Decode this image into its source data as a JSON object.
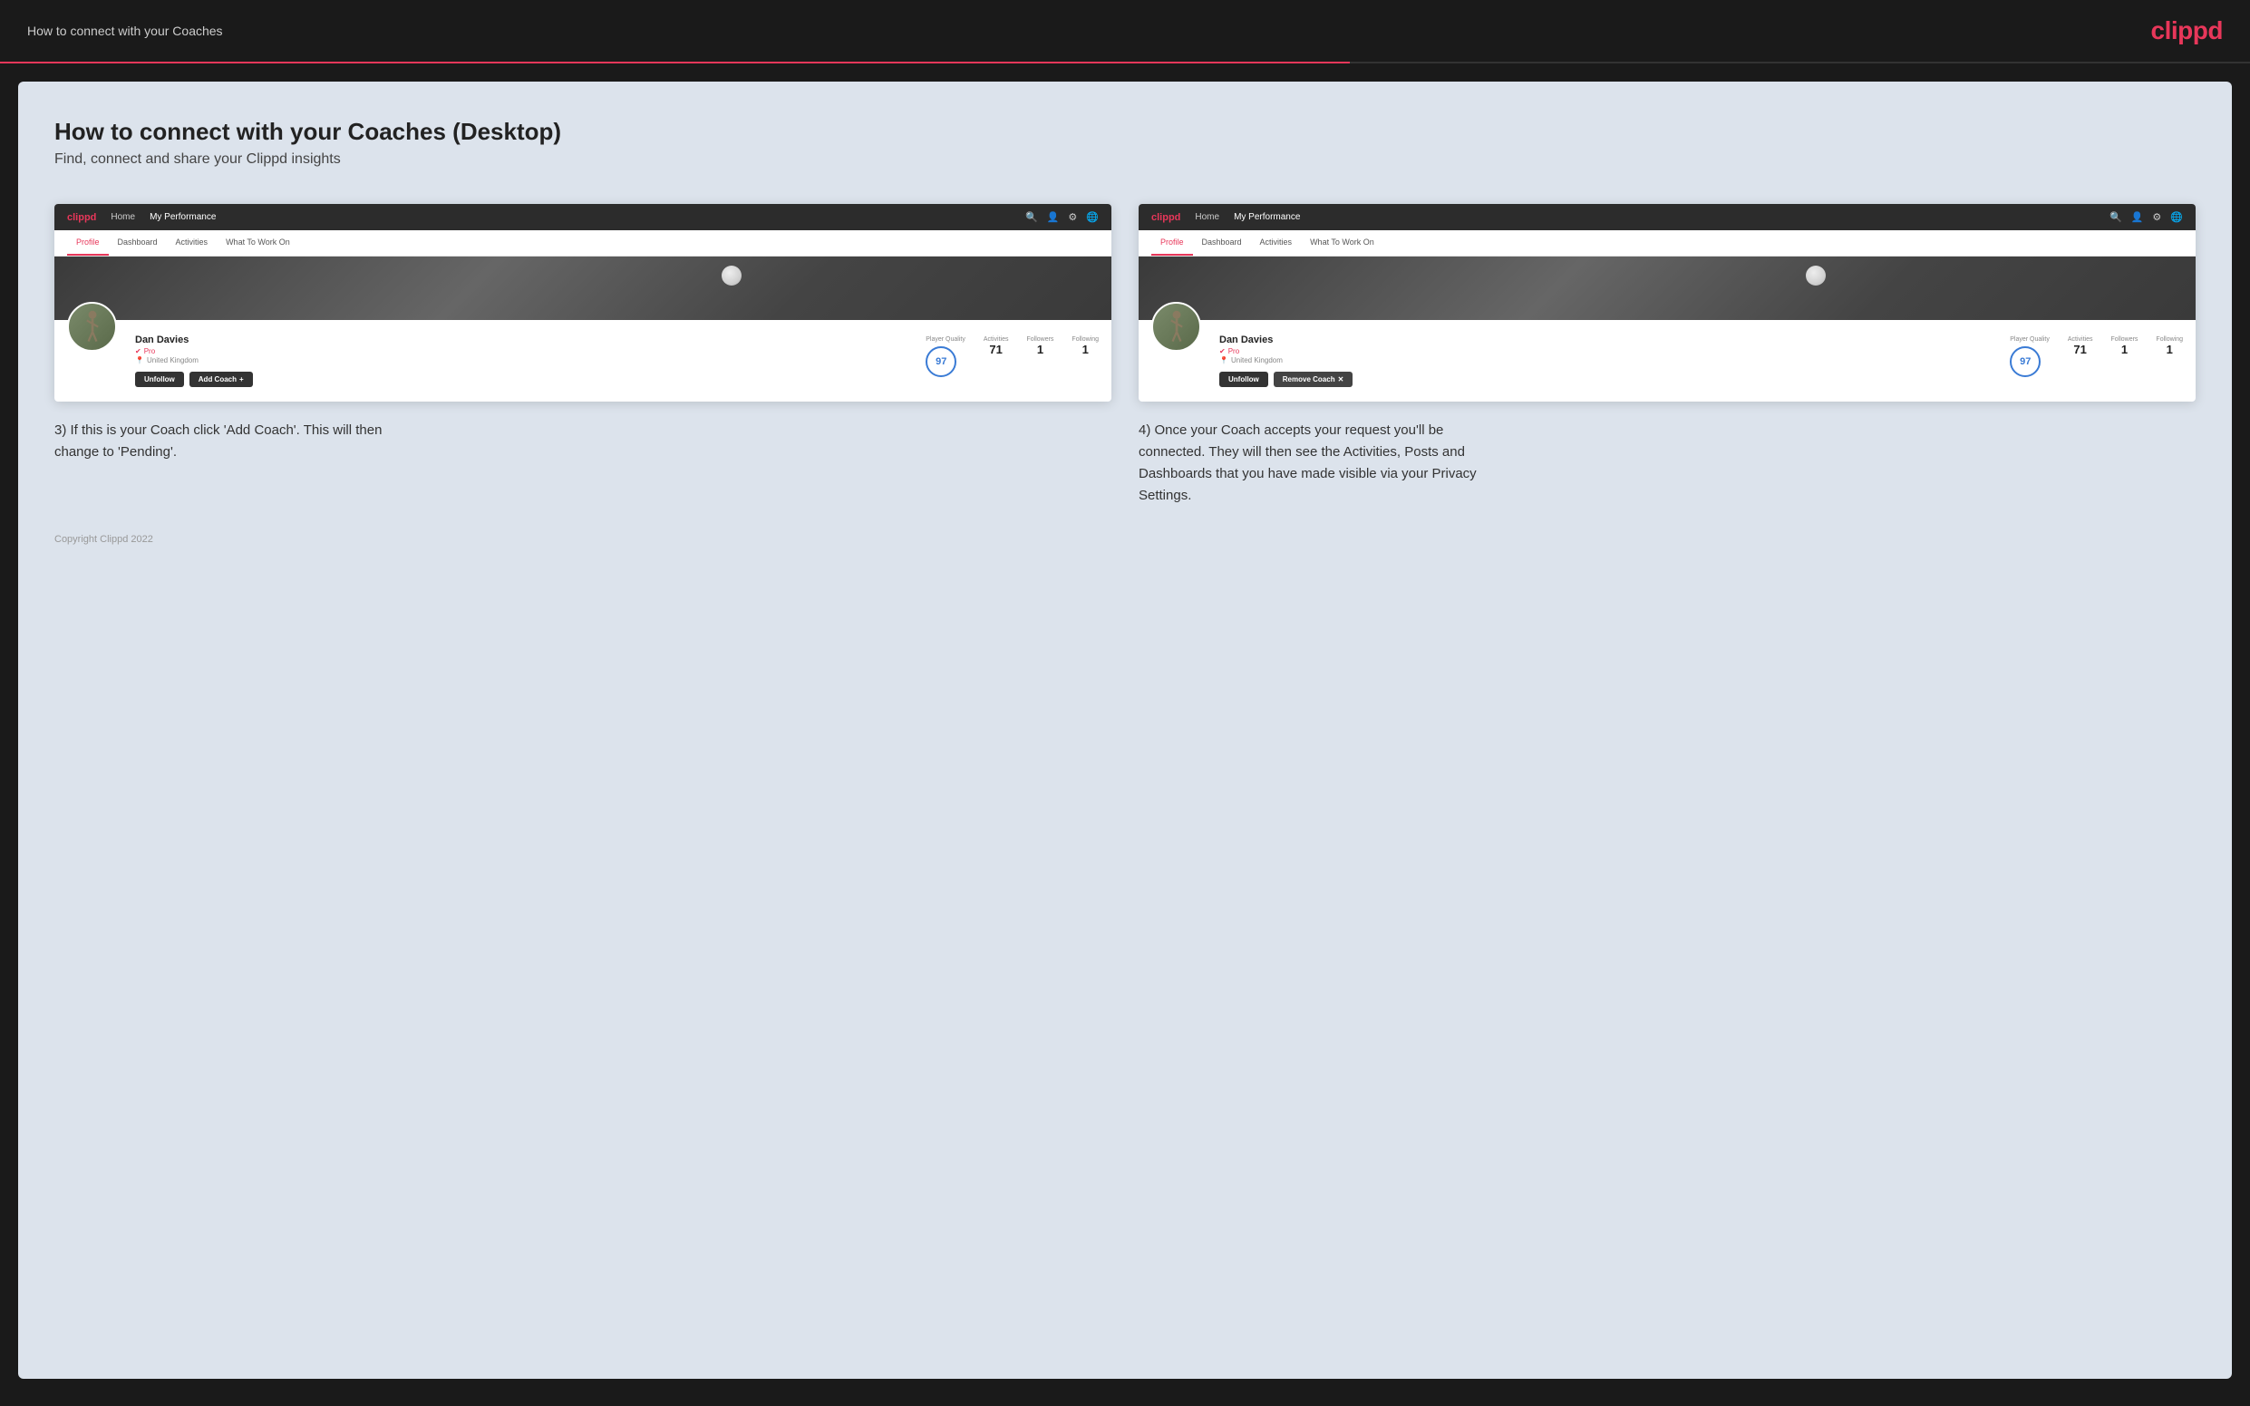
{
  "header": {
    "title": "How to connect with your Coaches",
    "logo": "clippd"
  },
  "page": {
    "title": "How to connect with your Coaches (Desktop)",
    "subtitle": "Find, connect and share your Clippd insights"
  },
  "screenshot_left": {
    "nav": {
      "logo": "clippd",
      "links": [
        "Home",
        "My Performance"
      ]
    },
    "tabs": [
      "Profile",
      "Dashboard",
      "Activities",
      "What To Work On"
    ],
    "active_tab": "Profile",
    "player": {
      "name": "Dan Davies",
      "pro": "Pro",
      "location": "United Kingdom",
      "player_quality_label": "Player Quality",
      "player_quality": "97",
      "activities_label": "Activities",
      "activities": "71",
      "followers_label": "Followers",
      "followers": "1",
      "following_label": "Following",
      "following": "1"
    },
    "buttons": {
      "unfollow": "Unfollow",
      "add_coach": "Add Coach"
    }
  },
  "screenshot_right": {
    "nav": {
      "logo": "clippd",
      "links": [
        "Home",
        "My Performance"
      ]
    },
    "tabs": [
      "Profile",
      "Dashboard",
      "Activities",
      "What To Work On"
    ],
    "active_tab": "Profile",
    "player": {
      "name": "Dan Davies",
      "pro": "Pro",
      "location": "United Kingdom",
      "player_quality_label": "Player Quality",
      "player_quality": "97",
      "activities_label": "Activities",
      "activities": "71",
      "followers_label": "Followers",
      "followers": "1",
      "following_label": "Following",
      "following": "1"
    },
    "buttons": {
      "unfollow": "Unfollow",
      "remove_coach": "Remove Coach"
    }
  },
  "descriptions": {
    "left": "3) If this is your Coach click 'Add Coach'. This will then change to 'Pending'.",
    "right": "4) Once your Coach accepts your request you'll be connected. They will then see the Activities, Posts and Dashboards that you have made visible via your Privacy Settings."
  },
  "footer": {
    "copyright": "Copyright Clippd 2022"
  }
}
